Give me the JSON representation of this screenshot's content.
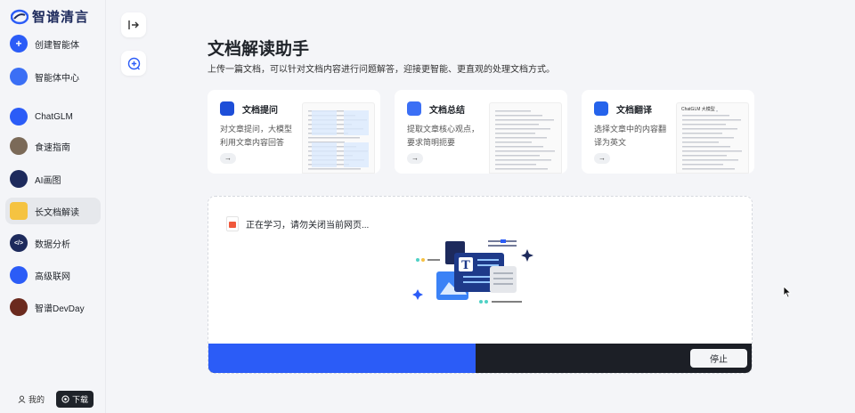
{
  "brand": {
    "name": "智谱清言"
  },
  "sidebar": {
    "items": [
      {
        "label": "创建智能体",
        "icon": "plus-icon",
        "color": "#2b5cf7",
        "active": false
      },
      {
        "label": "智能体中心",
        "icon": "apps-icon",
        "color": "#3b6ff5",
        "active": false
      },
      {
        "label": "ChatGLM",
        "icon": "chatglm-icon",
        "color": "#2b5cf7",
        "active": false
      },
      {
        "label": "食速指南",
        "icon": "food-icon",
        "color": "#7b6a58",
        "active": false
      },
      {
        "label": "AI画图",
        "icon": "paint-icon",
        "color": "#1d2a5c",
        "active": false
      },
      {
        "label": "长文档解读",
        "icon": "folder-icon",
        "color": "#f5c341",
        "active": true
      },
      {
        "label": "数据分析",
        "icon": "code-icon",
        "color": "#1d2a5c",
        "active": false
      },
      {
        "label": "高级联网",
        "icon": "globe-icon",
        "color": "#2b5cf7",
        "active": false
      },
      {
        "label": "智谱DevDay",
        "icon": "devday-icon",
        "color": "#6b2a1e",
        "active": false
      }
    ],
    "mine_label": "我的",
    "download_label": "下载"
  },
  "main": {
    "title": "文档解读助手",
    "subtitle": "上传一篇文档，可以针对文档内容进行问题解答，迎接更智能、更直观的处理文档方式。",
    "cards": [
      {
        "title": "文档提问",
        "desc": "对文章提问，大模型利用文章内容回答",
        "icon_color": "#1d4ed8",
        "icon": "doc-question-icon",
        "arrow": "→"
      },
      {
        "title": "文档总结",
        "desc": "提取文章核心观点，要求简明扼要",
        "icon_color": "#3b6ff5",
        "icon": "doc-summary-icon",
        "arrow": "→"
      },
      {
        "title": "文档翻译",
        "desc": "选择文章中的内容翻译为英文",
        "icon_color": "#2563eb",
        "icon": "translate-icon",
        "arrow": "→",
        "thumb_title": "ChatGLM 大模型"
      }
    ],
    "upload": {
      "file_status": "正在学习，请勿关闭当前网页...",
      "progress": 0.49,
      "stop_label": "停止"
    }
  }
}
